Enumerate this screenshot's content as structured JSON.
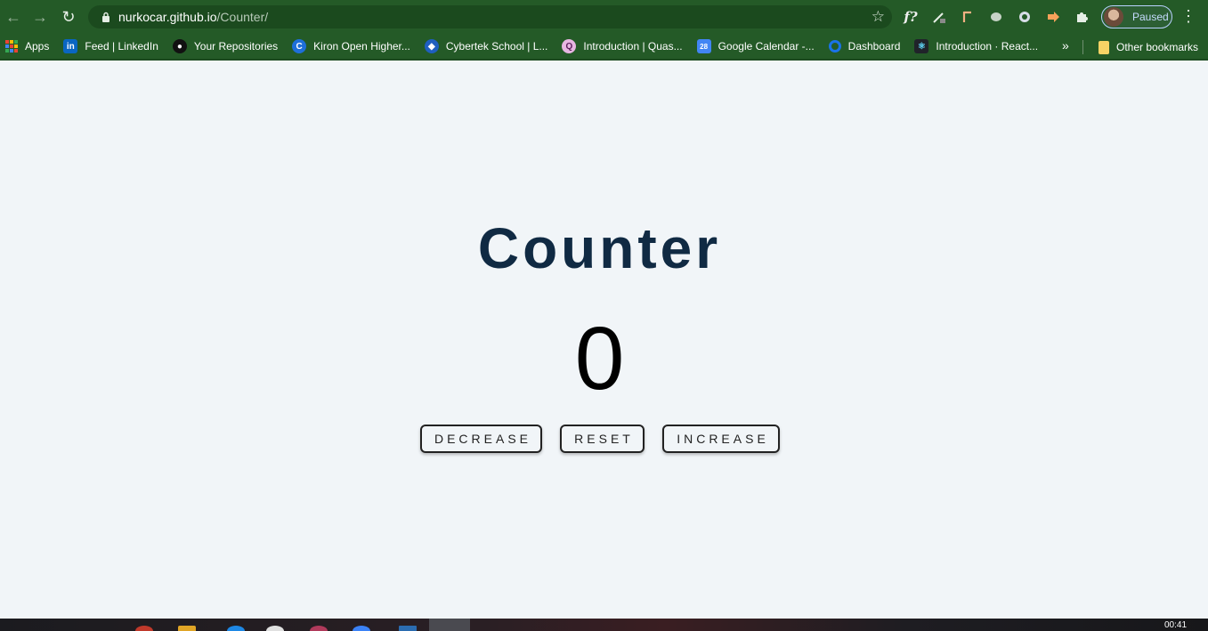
{
  "browser": {
    "url_host": "nurkocar.github.io",
    "url_path": "/Counter/",
    "profile_status": "Paused",
    "ext_f_label": "f?"
  },
  "bookmarks": {
    "items": [
      {
        "label": "Apps",
        "icon": "apps-grid-icon"
      },
      {
        "label": "Feed | LinkedIn",
        "icon": "linkedin-icon",
        "color": "#0a66c2"
      },
      {
        "label": "Your Repositories",
        "icon": "github-icon",
        "color": "#111111"
      },
      {
        "label": "Kiron Open Higher...",
        "icon": "kiron-icon",
        "color": "#1e6fd9"
      },
      {
        "label": "Cybertek School | L...",
        "icon": "cybertek-icon",
        "color": "#1f5fbf"
      },
      {
        "label": "Introduction | Quas...",
        "icon": "quasar-icon",
        "color": "#e7b6e2"
      },
      {
        "label": "Google Calendar -...",
        "icon": "calendar-icon",
        "color": "#4285f4"
      },
      {
        "label": "Dashboard",
        "icon": "dashboard-icon",
        "color": "#1a73e8"
      },
      {
        "label": "Introduction · React...",
        "icon": "react-icon",
        "color": "#20232a"
      }
    ],
    "more": "»",
    "other": "Other bookmarks"
  },
  "app": {
    "title": "Counter",
    "value": "0",
    "buttons": {
      "decrease": "DECREASE",
      "reset": "RESET",
      "increase": "INCREASE"
    },
    "colors": {
      "title": "#102a43",
      "background": "#f1f5f8"
    }
  },
  "taskbar": {
    "time": "00:41"
  }
}
